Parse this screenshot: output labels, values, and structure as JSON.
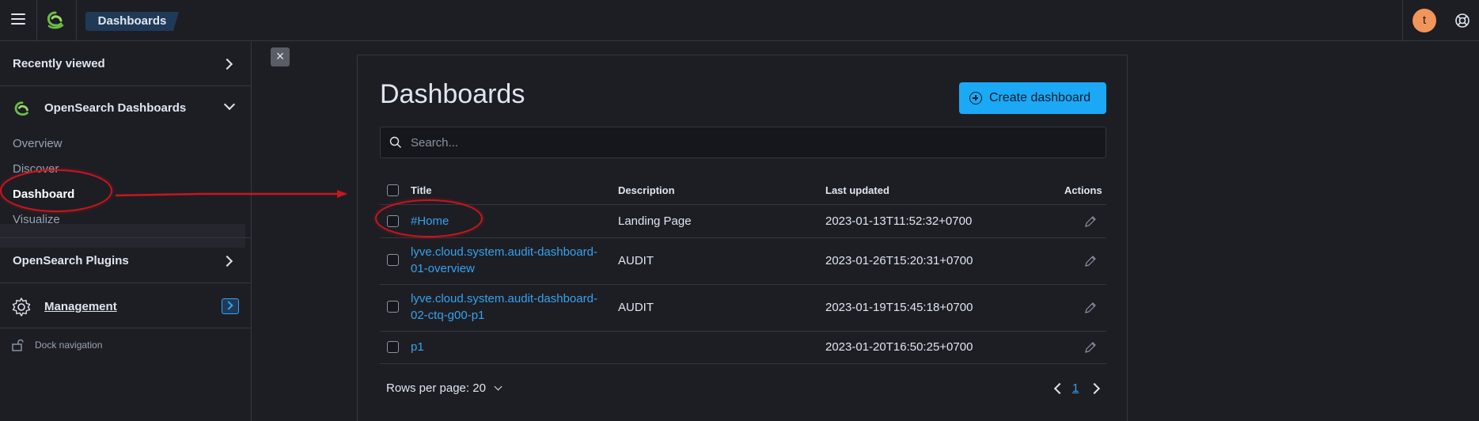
{
  "header": {
    "breadcrumb": "Dashboards",
    "avatar_initial": "t"
  },
  "sidenav": {
    "recently_viewed": "Recently viewed",
    "opensearch_dashboards": "OpenSearch Dashboards",
    "links": [
      "Overview",
      "Discover",
      "Dashboard",
      "Visualize"
    ],
    "opensearch_plugins": "OpenSearch Plugins",
    "management": "Management",
    "dock_navigation": "Dock navigation"
  },
  "main": {
    "title": "Dashboards",
    "create_button": "Create dashboard",
    "search_placeholder": "Search...",
    "columns": [
      "Title",
      "Description",
      "Last updated",
      "Actions"
    ],
    "rows": [
      {
        "title": "#Home",
        "description": "Landing Page",
        "updated": "2023-01-13T11:52:32+0700"
      },
      {
        "title": "lyve.cloud.system.audit-dashboard-01-overview",
        "title_l1": "lyve.cloud.system.audit-dashboard-",
        "title_l2": "01-overview",
        "description": "AUDIT",
        "updated": "2023-01-26T15:20:31+0700"
      },
      {
        "title": "lyve.cloud.system.audit-dashboard-02-ctq-g00-p1",
        "title_l1": "lyve.cloud.system.audit-dashboard-",
        "title_l2": "02-ctq-g00-p1",
        "description": "AUDIT",
        "updated": "2023-01-19T15:45:18+0700"
      },
      {
        "title": "p1",
        "description": "",
        "updated": "2023-01-20T16:50:25+0700"
      }
    ],
    "rows_per_page": "Rows per page: 20",
    "current_page": "1"
  },
  "colors": {
    "accent": "#1ba9f5",
    "link": "#36a2ef",
    "annotation": "#c8161d",
    "avatar": "#f1955a"
  },
  "icons": [
    "menu-icon",
    "opensearch-logo-icon",
    "help-icon",
    "chevron-right-icon",
    "chevron-down-icon",
    "gear-icon",
    "lock-icon",
    "close-icon",
    "plus-circle-icon",
    "search-icon",
    "pencil-icon"
  ]
}
